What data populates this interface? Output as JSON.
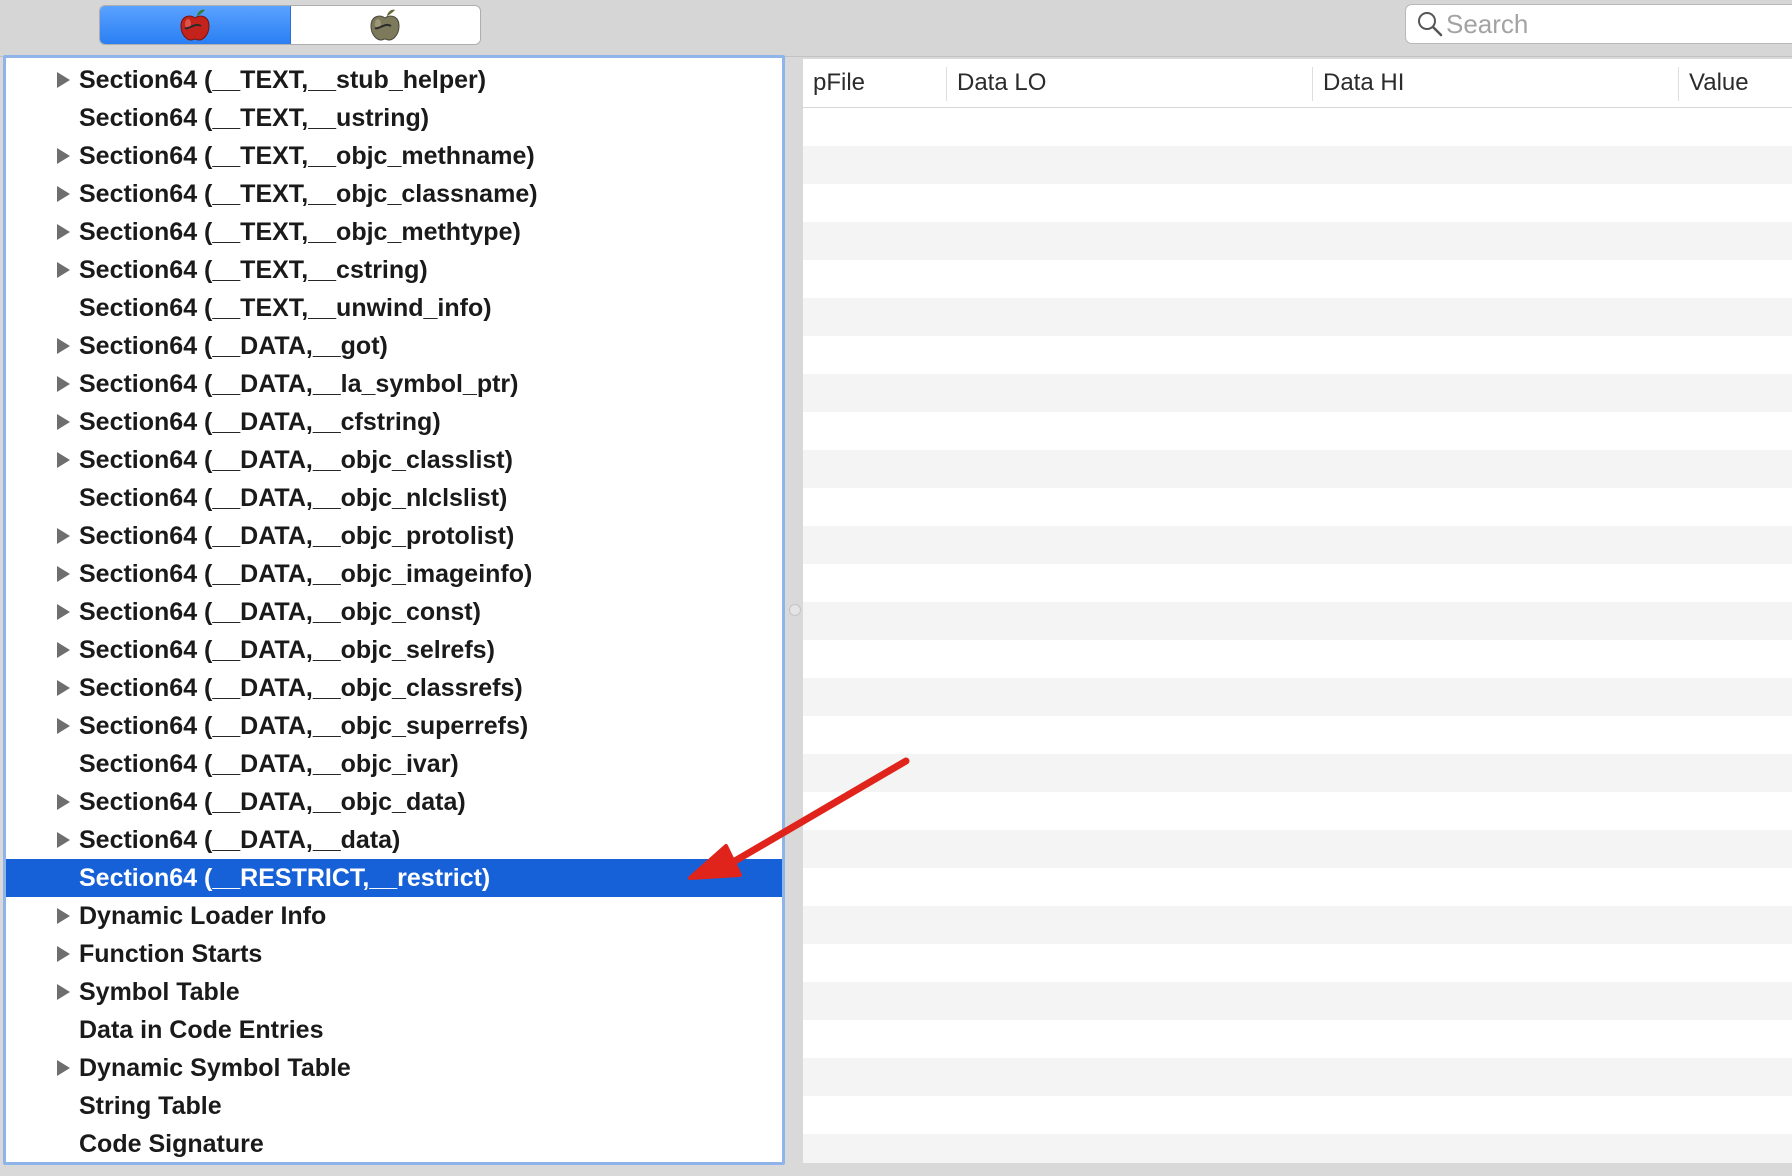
{
  "toolbar": {
    "segments": [
      {
        "icon": "red-apple-icon",
        "selected": true
      },
      {
        "icon": "gray-apple-icon",
        "selected": false
      }
    ],
    "search_placeholder": "Search"
  },
  "outline": {
    "items": [
      {
        "label": "Section64 (__TEXT,__stub_helper)",
        "expandable": true
      },
      {
        "label": "Section64 (__TEXT,__ustring)",
        "expandable": false
      },
      {
        "label": "Section64 (__TEXT,__objc_methname)",
        "expandable": true
      },
      {
        "label": "Section64 (__TEXT,__objc_classname)",
        "expandable": true
      },
      {
        "label": "Section64 (__TEXT,__objc_methtype)",
        "expandable": true
      },
      {
        "label": "Section64 (__TEXT,__cstring)",
        "expandable": true
      },
      {
        "label": "Section64 (__TEXT,__unwind_info)",
        "expandable": false
      },
      {
        "label": "Section64 (__DATA,__got)",
        "expandable": true
      },
      {
        "label": "Section64 (__DATA,__la_symbol_ptr)",
        "expandable": true
      },
      {
        "label": "Section64 (__DATA,__cfstring)",
        "expandable": true
      },
      {
        "label": "Section64 (__DATA,__objc_classlist)",
        "expandable": true
      },
      {
        "label": "Section64 (__DATA,__objc_nlclslist)",
        "expandable": false
      },
      {
        "label": "Section64 (__DATA,__objc_protolist)",
        "expandable": true
      },
      {
        "label": "Section64 (__DATA,__objc_imageinfo)",
        "expandable": true
      },
      {
        "label": "Section64 (__DATA,__objc_const)",
        "expandable": true
      },
      {
        "label": "Section64 (__DATA,__objc_selrefs)",
        "expandable": true
      },
      {
        "label": "Section64 (__DATA,__objc_classrefs)",
        "expandable": true
      },
      {
        "label": "Section64 (__DATA,__objc_superrefs)",
        "expandable": true
      },
      {
        "label": "Section64 (__DATA,__objc_ivar)",
        "expandable": false
      },
      {
        "label": "Section64 (__DATA,__objc_data)",
        "expandable": true
      },
      {
        "label": "Section64 (__DATA,__data)",
        "expandable": true
      },
      {
        "label": "Section64 (__RESTRICT,__restrict)",
        "expandable": false,
        "selected": true
      },
      {
        "label": "Dynamic Loader Info",
        "expandable": true
      },
      {
        "label": "Function Starts",
        "expandable": true
      },
      {
        "label": "Symbol Table",
        "expandable": true
      },
      {
        "label": "Data in Code Entries",
        "expandable": false
      },
      {
        "label": "Dynamic Symbol Table",
        "expandable": true
      },
      {
        "label": "String Table",
        "expandable": false
      },
      {
        "label": "Code Signature",
        "expandable": false
      }
    ]
  },
  "table": {
    "columns": [
      "pFile",
      "Data LO",
      "Data HI",
      "Value"
    ]
  },
  "colors": {
    "selection": "#1761d8",
    "annotation_arrow": "#e0241b",
    "outline_focus_border": "#8fb4ea"
  }
}
